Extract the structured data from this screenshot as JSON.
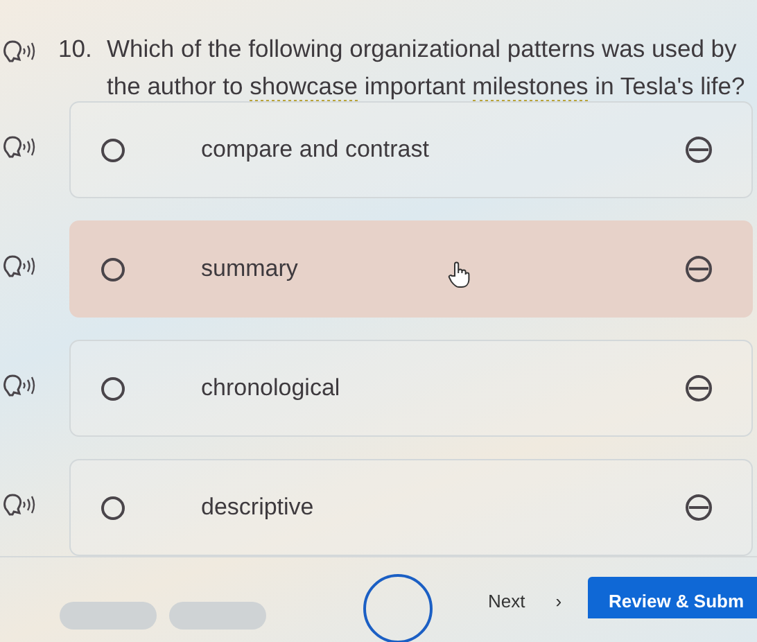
{
  "question": {
    "number": "10.",
    "segments": [
      {
        "text": "Which of the following organizational patterns was used by the author to ",
        "kind": "plain"
      },
      {
        "text": "showcase",
        "kind": "vocab"
      },
      {
        "text": " important ",
        "kind": "plain"
      },
      {
        "text": "milestones",
        "kind": "vocab"
      },
      {
        "text": " in Tesla's life?",
        "kind": "plain"
      }
    ]
  },
  "options": [
    {
      "label": "compare and contrast",
      "hovered": false,
      "selected": false
    },
    {
      "label": "summary",
      "hovered": true,
      "selected": false
    },
    {
      "label": "chronological",
      "hovered": false,
      "selected": false
    },
    {
      "label": "descriptive",
      "hovered": false,
      "selected": false
    }
  ],
  "footer": {
    "next": "Next",
    "next_arrow": "›",
    "submit": "Review & Subm"
  }
}
